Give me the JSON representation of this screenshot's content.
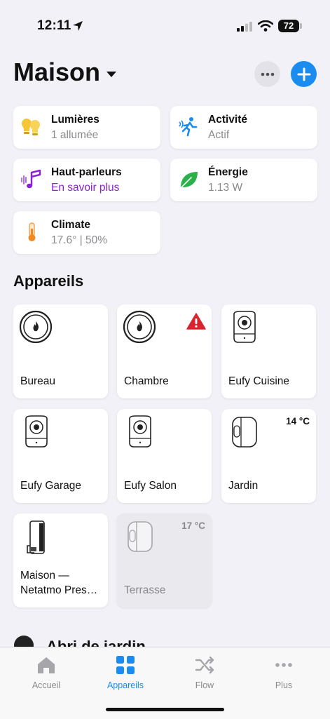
{
  "status_bar": {
    "time": "12:11",
    "battery": "72"
  },
  "header": {
    "title": "Maison"
  },
  "summary_cards": [
    {
      "title": "Lumières",
      "subtitle": "1 allumée"
    },
    {
      "title": "Activité",
      "subtitle": "Actif"
    },
    {
      "title": "Haut-parleurs",
      "subtitle": "En savoir plus"
    },
    {
      "title": "Énergie",
      "subtitle": "1.13 W"
    },
    {
      "title": "Climate",
      "subtitle": "17.6° | 50%"
    }
  ],
  "devices_section": {
    "title": "Appareils"
  },
  "devices": [
    {
      "name": "Bureau"
    },
    {
      "name": "Chambre"
    },
    {
      "name": "Eufy Cuisine"
    },
    {
      "name": "Eufy Garage"
    },
    {
      "name": "Eufy Salon"
    },
    {
      "name": "Jardin",
      "temp": "14 °C"
    },
    {
      "name": "Maison — Netatmo Pres…"
    },
    {
      "name": "Terrasse",
      "temp": "17 °C"
    }
  ],
  "next_section": {
    "title": "Abri de jardin"
  },
  "tabbar": {
    "tabs": [
      {
        "label": "Accueil"
      },
      {
        "label": "Appareils"
      },
      {
        "label": "Flow"
      },
      {
        "label": "Plus"
      }
    ]
  },
  "colors": {
    "accent": "#1a8cf0",
    "warning": "#d9232f",
    "purple": "#8a22d4",
    "energy": "#2bb04a"
  }
}
